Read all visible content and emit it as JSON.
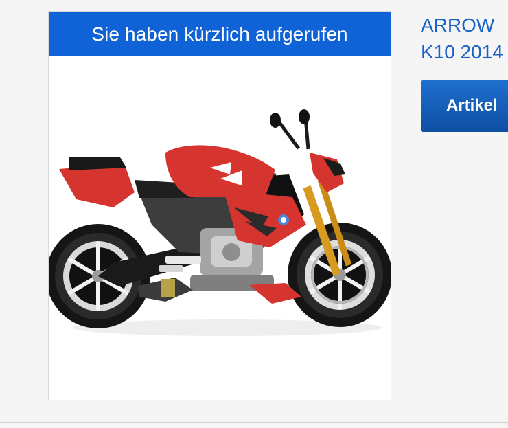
{
  "recently_viewed": {
    "heading": "Sie haben kürzlich aufgerufen",
    "product_image_alt": "red motorcycle"
  },
  "product": {
    "title_line1": "ARROW",
    "title_line2": "K10 2014"
  },
  "article_button": {
    "label": "Artikel"
  },
  "colors": {
    "header_blue": "#0f63d6",
    "link_blue": "#1a62c8",
    "button_blue": "#1559b8",
    "motorcycle_red": "#d5342f"
  }
}
